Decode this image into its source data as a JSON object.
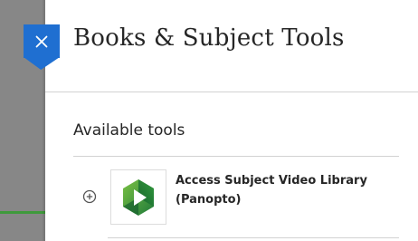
{
  "panel": {
    "title": "Books & Subject Tools",
    "section_heading": "Available tools"
  },
  "tools": [
    {
      "name": "Access Subject Video Library (Panopto)",
      "icon": "panopto-logo",
      "add_icon": "plus-circle-icon"
    }
  ],
  "colors": {
    "accent": "#1f6fd1",
    "backdrop": "#878787",
    "backdrop_line": "#3f9a3c"
  }
}
